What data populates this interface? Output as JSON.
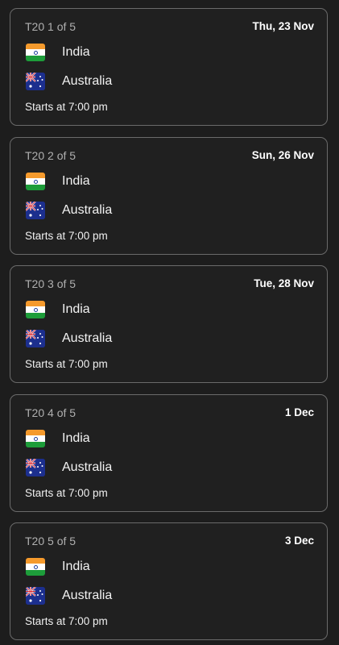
{
  "matches": [
    {
      "series": "T20 1 of 5",
      "date": "Thu, 23 Nov",
      "team1": "India",
      "team2": "Australia",
      "start": "Starts at 7:00 pm"
    },
    {
      "series": "T20 2 of 5",
      "date": "Sun, 26 Nov",
      "team1": "India",
      "team2": "Australia",
      "start": "Starts at 7:00 pm"
    },
    {
      "series": "T20 3 of 5",
      "date": "Tue, 28 Nov",
      "team1": "India",
      "team2": "Australia",
      "start": "Starts at 7:00 pm"
    },
    {
      "series": "T20 4 of 5",
      "date": "1 Dec",
      "team1": "India",
      "team2": "Australia",
      "start": "Starts at 7:00 pm"
    },
    {
      "series": "T20 5 of 5",
      "date": "3 Dec",
      "team1": "India",
      "team2": "Australia",
      "start": "Starts at 7:00 pm"
    }
  ],
  "icons": {
    "team1_flag": "india-flag-icon",
    "team2_flag": "australia-flag-icon"
  },
  "colors": {
    "background": "#1d1d1d",
    "card_border": "#6a6a6a",
    "series_text": "#b0b0b0"
  }
}
